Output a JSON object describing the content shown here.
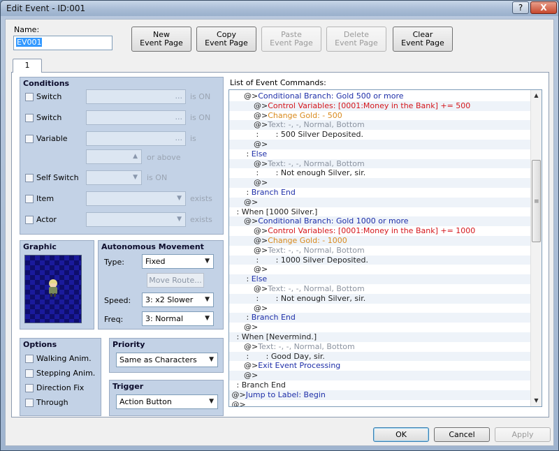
{
  "window": {
    "title": "Edit Event - ID:001",
    "help_label": "?",
    "close_label": "X"
  },
  "name": {
    "label": "Name:",
    "value": "EV001"
  },
  "page_buttons": {
    "new": [
      "New",
      "Event Page"
    ],
    "copy": [
      "Copy",
      "Event Page"
    ],
    "paste": [
      "Paste",
      "Event Page"
    ],
    "delete": [
      "Delete",
      "Event Page"
    ],
    "clear": [
      "Clear",
      "Event Page"
    ]
  },
  "tab": {
    "label": "1"
  },
  "conditions": {
    "title": "Conditions",
    "switch1": "Switch",
    "switch2": "Switch",
    "variable": "Variable",
    "self_switch": "Self Switch",
    "item": "Item",
    "actor": "Actor",
    "is_on": "is ON",
    "is": "is",
    "or_above": "or above",
    "exists": "exists",
    "dots": "..."
  },
  "graphic": {
    "title": "Graphic"
  },
  "autonomous": {
    "title": "Autonomous Movement",
    "type_label": "Type:",
    "type_value": "Fixed",
    "move_route": "Move Route...",
    "speed_label": "Speed:",
    "speed_value": "3: x2 Slower",
    "freq_label": "Freq:",
    "freq_value": "3: Normal"
  },
  "options": {
    "title": "Options",
    "walking": "Walking Anim.",
    "stepping": "Stepping Anim.",
    "direction_fix": "Direction Fix",
    "through": "Through"
  },
  "priority": {
    "title": "Priority",
    "value": "Same as Characters"
  },
  "trigger": {
    "title": "Trigger",
    "value": "Action Button"
  },
  "commands": {
    "label": "List of Event Commands:",
    "rows": [
      [
        "      @>",
        "Conditional Branch: Gold 500 or more",
        "cb"
      ],
      [
        "          @>",
        "Control Variables: [0001:Money in the Bank] += 500",
        "red"
      ],
      [
        "          @>",
        "Change Gold: - 500",
        "orange"
      ],
      [
        "          @>",
        "Text: -, -, Normal, Bottom",
        "meta"
      ],
      [
        "           :       ",
        ": 500 Silver Deposited.",
        "dark"
      ],
      [
        "          @>",
        "",
        "dark"
      ],
      [
        "       : ",
        "Else",
        "cb"
      ],
      [
        "          @>",
        "Text: -, -, Normal, Bottom",
        "meta"
      ],
      [
        "           :       ",
        ": Not enough Silver, sir.",
        "dark"
      ],
      [
        "          @>",
        "",
        "dark"
      ],
      [
        "       : ",
        "Branch End",
        "cb"
      ],
      [
        "      @>",
        "",
        "dark"
      ],
      [
        "   : ",
        "When [1000 Silver.]",
        "dark"
      ],
      [
        "      @>",
        "Conditional Branch: Gold 1000 or more",
        "cb"
      ],
      [
        "          @>",
        "Control Variables: [0001:Money in the Bank] += 1000",
        "red"
      ],
      [
        "          @>",
        "Change Gold: - 1000",
        "orange"
      ],
      [
        "          @>",
        "Text: -, -, Normal, Bottom",
        "meta"
      ],
      [
        "           :       ",
        ": 1000 Silver Deposited.",
        "dark"
      ],
      [
        "          @>",
        "",
        "dark"
      ],
      [
        "       : ",
        "Else",
        "cb"
      ],
      [
        "          @>",
        "Text: -, -, Normal, Bottom",
        "meta"
      ],
      [
        "           :       ",
        ": Not enough Silver, sir.",
        "dark"
      ],
      [
        "          @>",
        "",
        "dark"
      ],
      [
        "       : ",
        "Branch End",
        "cb"
      ],
      [
        "      @>",
        "",
        "dark"
      ],
      [
        "   : ",
        "When [Nevermind.]",
        "dark"
      ],
      [
        "      @>",
        "Text: -, -, Normal, Bottom",
        "meta"
      ],
      [
        "       :       ",
        ": Good Day, sir.",
        "dark"
      ],
      [
        "      @>",
        "Exit Event Processing",
        "cb"
      ],
      [
        "      @>",
        "",
        "dark"
      ],
      [
        "   : ",
        "Branch End",
        "dark"
      ],
      [
        " @>",
        "Jump to Label: Begin",
        "cb"
      ],
      [
        " @>",
        "",
        "dark"
      ]
    ]
  },
  "footer": {
    "ok": "OK",
    "cancel": "Cancel",
    "apply": "Apply"
  },
  "colors": {
    "selection": "#3399ff",
    "branch": "#1d2ea8",
    "variable": "#d4161b",
    "gold": "#d98a1d"
  }
}
